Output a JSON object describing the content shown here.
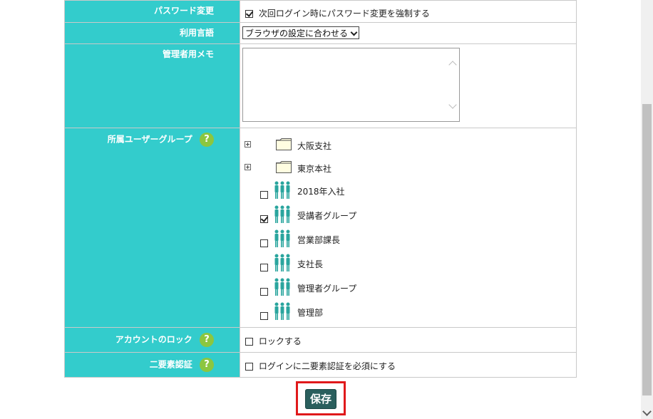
{
  "form": {
    "password_change": {
      "label": "パスワード変更",
      "checkbox_label": "次回ログイン時にパスワード変更を強制する",
      "checked": true
    },
    "language": {
      "label": "利用言語",
      "selected": "ブラウザの設定に合わせる"
    },
    "admin_memo": {
      "label": "管理者用メモ",
      "value": ""
    },
    "user_groups": {
      "label": "所属ユーザーグループ",
      "help_icon": "?",
      "folders": [
        {
          "name": "大阪支社",
          "icon": "folder-icon"
        },
        {
          "name": "東京本社",
          "icon": "folder-icon"
        }
      ],
      "groups": [
        {
          "name": "2018年入社",
          "checked": false
        },
        {
          "name": "受講者グループ",
          "checked": true
        },
        {
          "name": "営業部課長",
          "checked": false
        },
        {
          "name": "支社長",
          "checked": false
        },
        {
          "name": "管理者グループ",
          "checked": false
        },
        {
          "name": "管理部",
          "checked": false
        }
      ]
    },
    "account_lock": {
      "label": "アカウントのロック",
      "help_icon": "?",
      "checkbox_label": "ロックする",
      "checked": false
    },
    "two_factor": {
      "label": "二要素認証",
      "help_icon": "?",
      "checkbox_label": "ログインに二要素認証を必須にする",
      "checked": false
    }
  },
  "save_button": {
    "label": "保存"
  },
  "colors": {
    "label_bg": "#33cccc",
    "help_bg": "#8cc63f",
    "save_bg": "#2a5f5d",
    "highlight": "#e0191b",
    "person_icon": "#2aa59e"
  }
}
